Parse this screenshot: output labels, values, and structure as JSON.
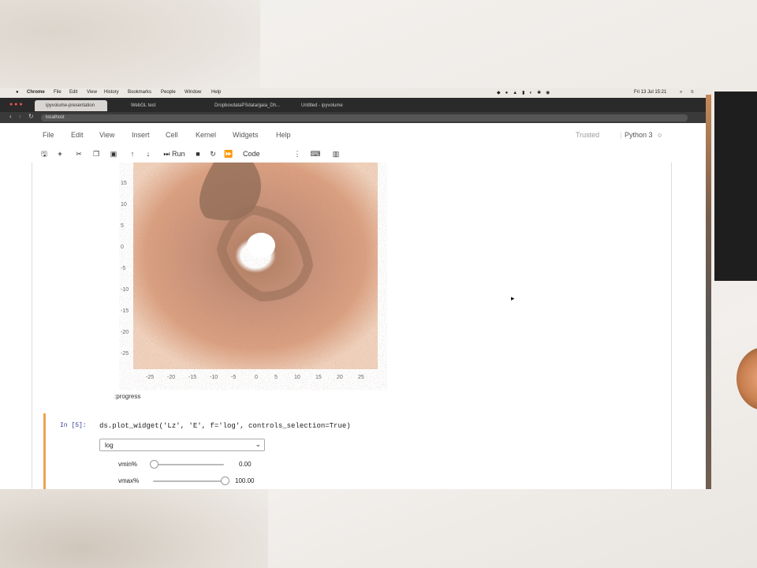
{
  "mac_menubar": {
    "app": "Chrome",
    "items": [
      "File",
      "Edit",
      "View",
      "History",
      "Bookmarks",
      "People",
      "Window",
      "Help"
    ],
    "clock": "Fri 13 Jul 15:21"
  },
  "browser": {
    "tabs": [
      "ipyvolume-presentation",
      "WebGL test",
      "DropboxdataPSdata/gaia_Dh...",
      "Untitled - ipyvolume"
    ],
    "url": "localhost"
  },
  "notebook": {
    "menu": [
      "File",
      "Edit",
      "View",
      "Insert",
      "Cell",
      "Kernel",
      "Widgets",
      "Help"
    ],
    "trusted": "Trusted",
    "kernel": "Python 3",
    "toolbar": {
      "run_label": "Run",
      "celltype": "Code"
    },
    "plot": {
      "y_ticks": [
        "15",
        "10",
        "5",
        "0",
        "-5",
        "-10",
        "-15",
        "-20",
        "-25"
      ],
      "x_ticks": [
        "-25",
        "-20",
        "-15",
        "-10",
        "-5",
        "0",
        "5",
        "10",
        "15",
        "20",
        "25"
      ]
    },
    "progress_label": ":progress",
    "cell": {
      "prompt": "In [5]:",
      "code": "ds.plot_widget('Lz', 'E', f='log', controls_selection=True)",
      "dropdown_value": "log",
      "vmin_label": "vmin%",
      "vmin_value": "0.00",
      "vmin_level": 0.0,
      "vmax_label": "vmax%",
      "vmax_value": "100.00",
      "vmax_level": 1.0
    }
  },
  "colors": {
    "accent_frame": "#f0a056",
    "density_dark": "#8a6550",
    "density_mid": "#c99170",
    "density_light": "#e4b08a"
  }
}
